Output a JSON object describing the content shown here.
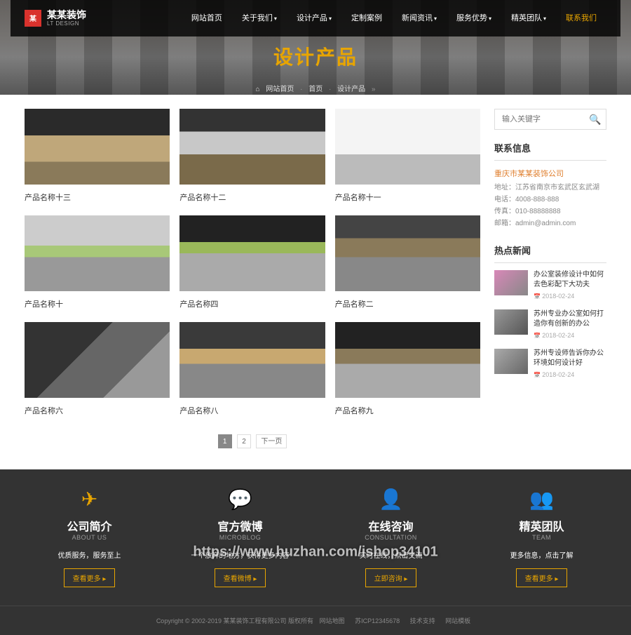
{
  "brand": {
    "name": "某某装饰",
    "sub": "LT DESIGN"
  },
  "nav": {
    "items": [
      "网站首页",
      "关于我们",
      "设计产品",
      "定制案例",
      "新闻资讯",
      "服务优势",
      "精英团队"
    ],
    "contact": "联系我们"
  },
  "hero": {
    "title": "设计产品"
  },
  "breadcrumb": {
    "home_icon": "⌂",
    "home": "网站首页",
    "sep1": "首页",
    "current": "设计产品"
  },
  "products": [
    {
      "title": "产品名称十三",
      "thumbClass": "t1"
    },
    {
      "title": "产品名称十二",
      "thumbClass": "t2"
    },
    {
      "title": "产品名称十一",
      "thumbClass": "t3"
    },
    {
      "title": "产品名称十",
      "thumbClass": "t4"
    },
    {
      "title": "产品名称四",
      "thumbClass": "t5"
    },
    {
      "title": "产品名称二",
      "thumbClass": "t6"
    },
    {
      "title": "产品名称六",
      "thumbClass": "t7"
    },
    {
      "title": "产品名称八",
      "thumbClass": "t8"
    },
    {
      "title": "产品名称九",
      "thumbClass": "t9"
    }
  ],
  "pager": {
    "p1": "1",
    "p2": "2",
    "next": "下一页"
  },
  "search": {
    "placeholder": "输入关键字"
  },
  "sidebar": {
    "contact_title": "联系信息",
    "company": "重庆市某某装饰公司",
    "lines": [
      "地址：江苏省南京市玄武区玄武湖",
      "电话：4008-888-888",
      "传真：010-88888888",
      "邮箱：admin@admin.com"
    ],
    "news_title": "热点新闻",
    "news": [
      {
        "title": "办公室装修设计中如何去色彩配下大功夫",
        "date": "2018-02-24",
        "thumb": "n1"
      },
      {
        "title": "苏州专业办公室如何打造你有创新的办公",
        "date": "2018-02-24",
        "thumb": "n2"
      },
      {
        "title": "苏州专设师告诉你办公环境如何设计好",
        "date": "2018-02-24",
        "thumb": "n3"
      }
    ]
  },
  "footer": {
    "cols": [
      {
        "icon": "✈",
        "title": "公司简介",
        "sub": "ABOUT US",
        "desc": "优质服务，服务至上",
        "btn": "查看更多"
      },
      {
        "icon": "💬",
        "title": "官方微博",
        "sub": "MICROBLOG",
        "desc": "一个放弃的地方，获得更多内容",
        "btn": "查看微博"
      },
      {
        "icon": "👤",
        "title": "在线咨询",
        "sub": "CONSULTATION",
        "desc": "实时在线，点击交流",
        "btn": "立即咨询"
      },
      {
        "icon": "👥",
        "title": "精英团队",
        "sub": "TEAM",
        "desc": "更多信息，点击了解",
        "btn": "查看更多"
      }
    ],
    "copyright": "Copyright © 2002-2019 某某装饰工程有限公司 版权所有",
    "links": [
      "网站地图",
      "苏ICP12345678",
      "技术支持",
      "网站模板"
    ]
  },
  "watermark": "https://www.huzhan.com/ishop34101"
}
